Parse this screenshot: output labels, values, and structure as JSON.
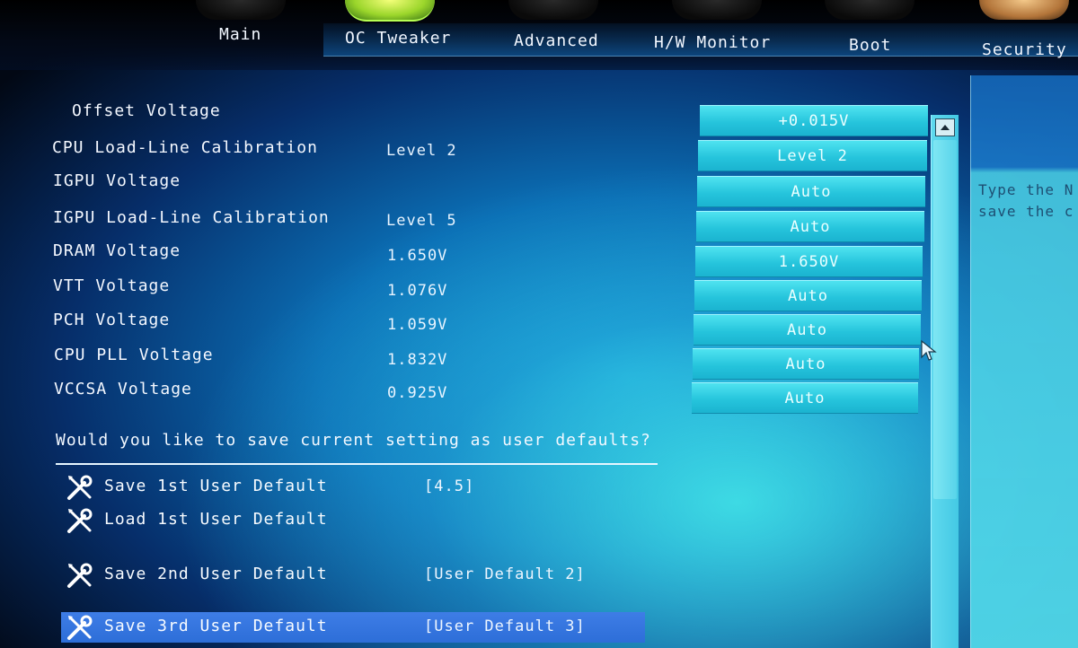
{
  "tabs": [
    {
      "label": "Main",
      "active": false,
      "icon": "main-icon"
    },
    {
      "label": "OC Tweaker",
      "active": true,
      "icon": "oc-tweaker-icon"
    },
    {
      "label": "Advanced",
      "active": false,
      "icon": "advanced-icon"
    },
    {
      "label": "H/W Monitor",
      "active": false,
      "icon": "hw-monitor-icon"
    },
    {
      "label": "Boot",
      "active": false,
      "icon": "boot-icon"
    },
    {
      "label": "Security",
      "active": false,
      "icon": "security-icon"
    }
  ],
  "settings": [
    {
      "name": "Offset Voltage",
      "current": "",
      "button": "+0.015V"
    },
    {
      "name": "CPU Load-Line Calibration",
      "current": "Level 2",
      "button": "Level 2"
    },
    {
      "name": "IGPU Voltage",
      "current": "",
      "button": "Auto"
    },
    {
      "name": "IGPU Load-Line Calibration",
      "current": "Level 5",
      "button": "Auto"
    },
    {
      "name": "DRAM Voltage",
      "current": "1.650V",
      "button": "1.650V"
    },
    {
      "name": "VTT Voltage",
      "current": "1.076V",
      "button": "Auto"
    },
    {
      "name": "PCH Voltage",
      "current": "1.059V",
      "button": "Auto"
    },
    {
      "name": "CPU PLL Voltage",
      "current": "1.832V",
      "button": "Auto"
    },
    {
      "name": "VCCSA Voltage",
      "current": "0.925V",
      "button": "Auto"
    }
  ],
  "question": "Would you like to save current setting as user defaults?",
  "user_defaults": [
    {
      "label": "Save 1st User Default",
      "value": "[4.5]",
      "selected": false
    },
    {
      "label": "Load 1st User Default",
      "value": "",
      "selected": false
    },
    {
      "label": "Save 2nd User Default",
      "value": "[User Default 2]",
      "selected": false
    },
    {
      "label": "Save 3rd User Default",
      "value": "[User Default 3]",
      "selected": true
    }
  ],
  "help": {
    "line1": "Type the N",
    "line2": "save the c"
  },
  "colors": {
    "button": "#25c4dc",
    "selected_row": "#2d6ed8",
    "active_tab_icon": "#9bd62b"
  }
}
